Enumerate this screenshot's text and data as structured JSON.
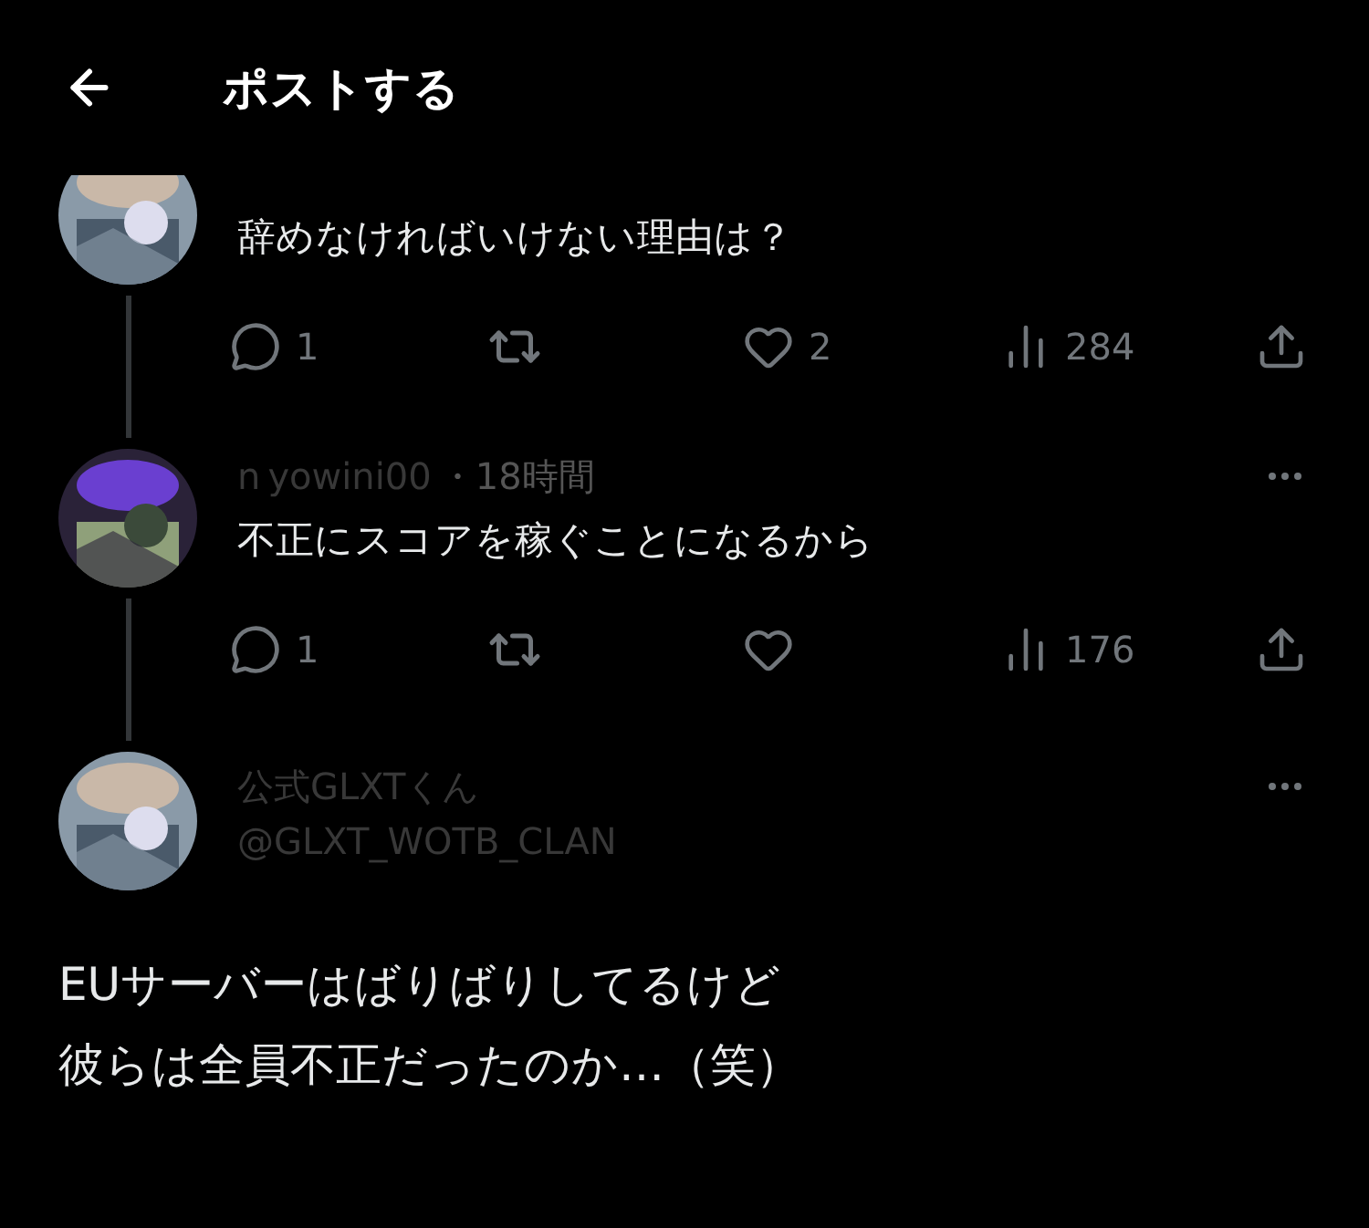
{
  "header": {
    "title": "ポストする"
  },
  "replies": [
    {
      "text": "辞めなければいけない理由は？",
      "thread_line": true,
      "liked": false,
      "stats": {
        "replies": "1",
        "likes": "2",
        "views": "284"
      }
    },
    {
      "name": "n",
      "handle": "yowini00",
      "time": "・18時間",
      "text": "不正にスコアを稼ぐことになるから",
      "thread_line": true,
      "liked": false,
      "stats": {
        "replies": "1",
        "views": "176"
      }
    }
  ],
  "main_post": {
    "name": "公式GLXTくん",
    "handle": "@GLXT_WOTB_CLAN",
    "lines": [
      "EUサーバーはばりばりしてるけど",
      "彼らは全員不正だったのか…（笑）"
    ]
  }
}
